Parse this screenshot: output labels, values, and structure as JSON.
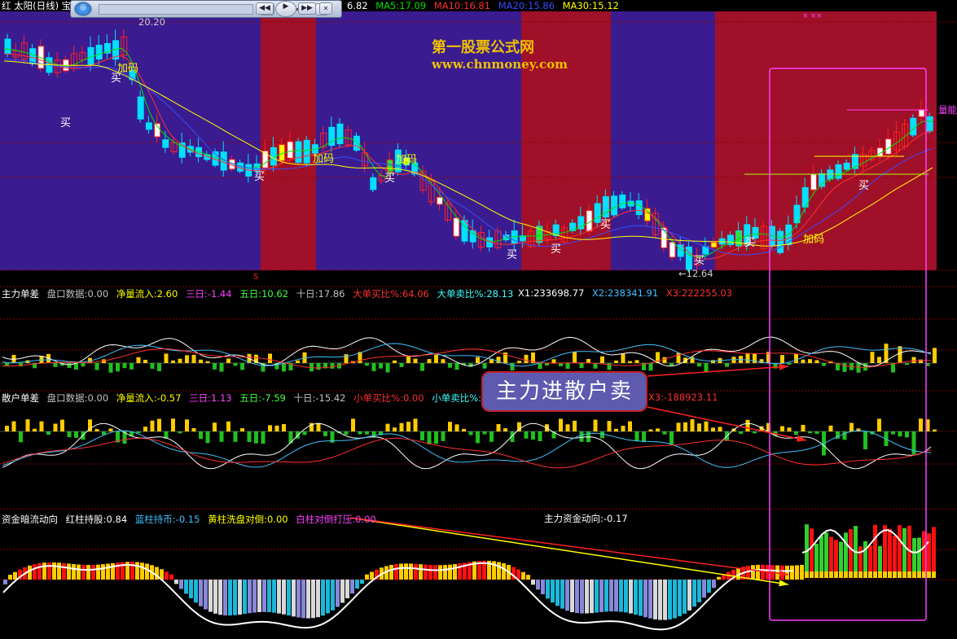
{
  "header": {
    "title": "红 太阳(日线) 宝",
    "close_price": "6.82",
    "ma": [
      {
        "label": "MA5:17.09",
        "color": "#00e000"
      },
      {
        "label": "MA10:16.81",
        "color": "#ff3030"
      },
      {
        "label": "MA20:15.86",
        "color": "#3a4cff"
      },
      {
        "label": "MA30:15.12",
        "color": "#ffff00"
      }
    ]
  },
  "watermark": {
    "line1": "第一股票公式网",
    "line2": "www.chnmoney.com"
  },
  "callout": {
    "text": "主力进散户卖"
  },
  "price_annotations": {
    "high": "20.20",
    "low": "←12.64",
    "right_label": "量能",
    "buy_label": "买",
    "add_label": "加码",
    "sell_marker": "S"
  },
  "panel1": {
    "name": "主力单差",
    "items": [
      {
        "text": "盘口数据:0.00",
        "color": "#c0c0c0"
      },
      {
        "text": "净量流入:2.60",
        "color": "#ffff00"
      },
      {
        "text": "三日:-1.44",
        "color": "#ff40ff"
      },
      {
        "text": "五日:10.62",
        "color": "#40ff40"
      },
      {
        "text": "十日:17.86",
        "color": "#c0c0c0"
      },
      {
        "text": "大单买比%:64.06",
        "color": "#ff3030"
      },
      {
        "text": "大单卖比%:28.13",
        "color": "#40ffff"
      }
    ],
    "x_items": [
      {
        "text": "X1:233698.77",
        "color": "#ffffff"
      },
      {
        "text": "X2:238341.91",
        "color": "#40c0ff"
      },
      {
        "text": "X3:222255.03",
        "color": "#ff3030"
      }
    ]
  },
  "panel2": {
    "name": "散户单差",
    "items": [
      {
        "text": "盘口数据:0.00",
        "color": "#c0c0c0"
      },
      {
        "text": "净量流入:-0.57",
        "color": "#ffff00"
      },
      {
        "text": "三日:1.13",
        "color": "#ff40ff"
      },
      {
        "text": "五日:-7.59",
        "color": "#40ff40"
      },
      {
        "text": "十日:-15.42",
        "color": "#c0c0c0"
      },
      {
        "text": "小单买比%:0.00",
        "color": "#ff3030"
      },
      {
        "text": "小单卖比%:7.81",
        "color": "#40ffff"
      }
    ],
    "x3": {
      "text": "X3:-188923.11",
      "color": "#ff3030"
    }
  },
  "panel3": {
    "name": "资金暗流动向",
    "items": [
      {
        "text": "红柱持股:0.84",
        "color": "#ffffff"
      },
      {
        "text": "蓝柱持币:-0.15",
        "color": "#40c0ff"
      },
      {
        "text": "黄柱洗盘对倒:0.00",
        "color": "#ffff00"
      },
      {
        "text": "白柱对倒打压:0.00",
        "color": "#ff40ff"
      }
    ],
    "main_flow": "主力资金动向:-0.17"
  },
  "colors": {
    "up": "#ff2020",
    "down": "#00e0ff",
    "band_red": "#a01028",
    "band_blue": "#3a1c90",
    "grid": "#8a0000",
    "highlight_box": "#ff40ff",
    "arrow_red": "#ff2020",
    "arrow_yellow": "#ffff00"
  },
  "chart_data": {
    "type": "candlestick",
    "approx_range": [
      12.64,
      20.2
    ],
    "series": [
      {
        "name": "MA5",
        "value": 17.09
      },
      {
        "name": "MA10",
        "value": 16.81
      },
      {
        "name": "MA20",
        "value": 15.86
      },
      {
        "name": "MA30",
        "value": 15.12
      }
    ],
    "markers": [
      "买",
      "加码"
    ],
    "indicators": [
      {
        "name": "主力单差",
        "净量流入": 2.6,
        "三日": -1.44,
        "五日": 10.62,
        "十日": 17.86,
        "大单买比%": 64.06,
        "大单卖比%": 28.13,
        "X1": 233698.77,
        "X2": 238341.91,
        "X3": 222255.03
      },
      {
        "name": "散户单差",
        "净量流入": -0.57,
        "三日": 1.13,
        "五日": -7.59,
        "十日": -15.42,
        "小单买比%": 0.0,
        "小单卖比%": 7.81,
        "X3": -188923.11
      },
      {
        "name": "资金暗流动向",
        "红柱持股": 0.84,
        "蓝柱持币": -0.15,
        "黄柱洗盘对倒": 0.0,
        "白柱对倒打压": 0.0,
        "主力资金动向": -0.17
      }
    ]
  },
  "icons": {
    "media_controls": [
      "rewind-icon",
      "play-icon",
      "forward-icon",
      "volume-icon"
    ]
  }
}
